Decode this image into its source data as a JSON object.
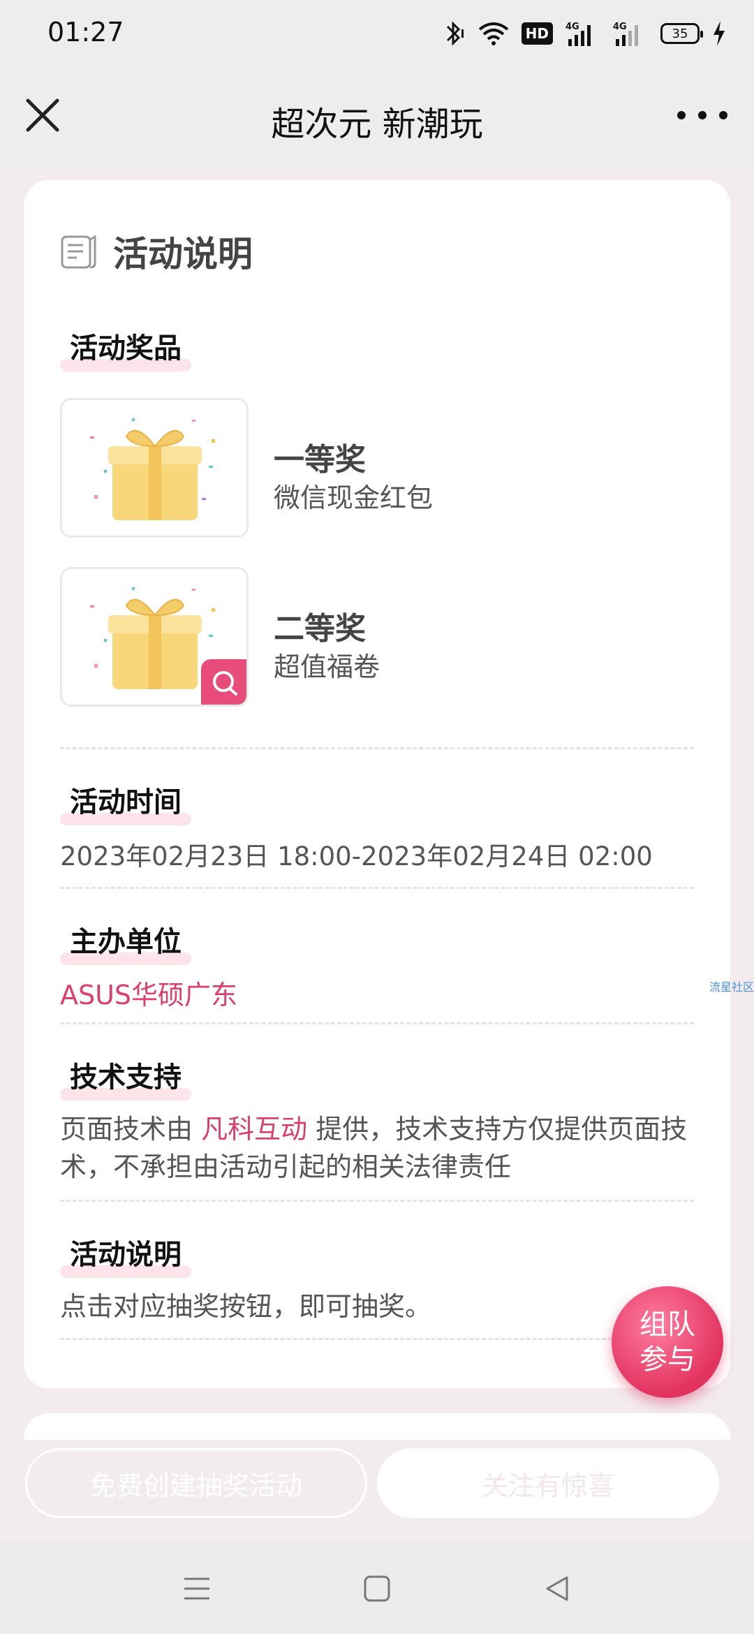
{
  "status_bar": {
    "time": "01:27",
    "hd_label": "HD",
    "net_label_1": "4G",
    "net_label_2": "4G",
    "battery": "35"
  },
  "title_bar": {
    "title": "超次元 新潮玩"
  },
  "card": {
    "header_title": "活动说明",
    "prizes_label": "活动奖品",
    "prizes": [
      {
        "name": "一等奖",
        "desc": "微信现金红包"
      },
      {
        "name": "二等奖",
        "desc": "超值福卷"
      }
    ],
    "time_label": "活动时间",
    "time_value": "2023年02月23日 18:00-2023年02月24日 02:00",
    "host_label": "主办单位",
    "host_value": "ASUS华硕广东",
    "tech_label": "技术支持",
    "tech_prefix": "页面技术由 ",
    "tech_provider": "凡科互动",
    "tech_suffix_line1": " 提供，技术支持方仅提供页面技",
    "tech_line2": "术，不承担由活动引起的相关法律责任",
    "desc_label": "活动说明",
    "desc_value": "点击对应抽奖按钮，即可抽奖。"
  },
  "floating": {
    "team_line1": "组队",
    "team_line2": "参与",
    "side_tag": "流星社区"
  },
  "bottom": {
    "create_label": "免费创建抽奖活动",
    "follow_label": "关注有惊喜"
  },
  "colors": {
    "accent": "#e84c7a",
    "highlight": "#fde3ea"
  }
}
